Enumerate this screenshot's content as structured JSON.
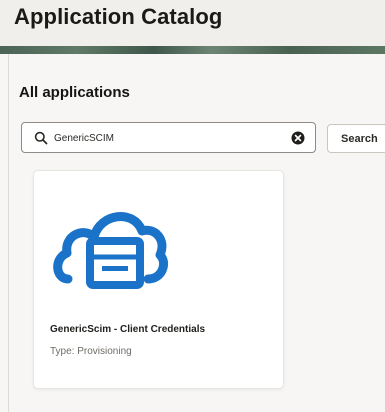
{
  "header": {
    "title": "Application Catalog"
  },
  "section": {
    "title": "All applications"
  },
  "search": {
    "value": "GenericSCIM",
    "icon": "search-icon",
    "clear_icon": "clear-icon",
    "button_label": "Search"
  },
  "cards": [
    {
      "name": "GenericScim - Client Credentials",
      "type": "Type: Provisioning",
      "icon": "cloud-app-icon",
      "icon_color": "#1a73c9"
    }
  ],
  "colors": {
    "accent": "#1a73c9",
    "banner": "#4f6a5a"
  }
}
